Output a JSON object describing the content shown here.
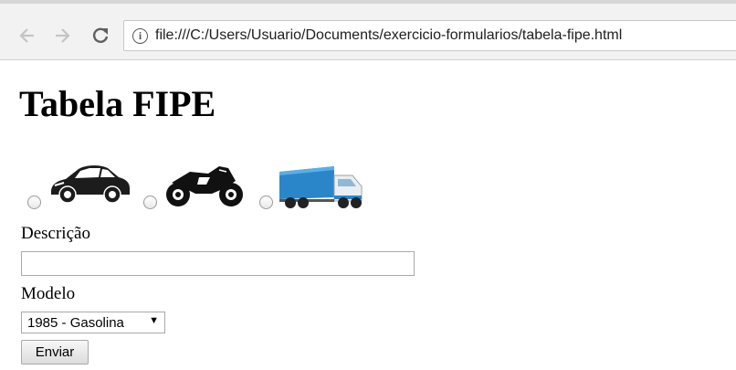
{
  "browser": {
    "url": "file:///C:/Users/Usuario/Documents/exercicio-formularios/tabela-fipe.html",
    "icons": {
      "back": "arrow-left-icon",
      "forward": "arrow-right-icon",
      "reload": "reload-icon",
      "info": "info-icon"
    },
    "info_glyph": "i"
  },
  "page": {
    "title": "Tabela FIPE",
    "vehicle_types": [
      {
        "icon": "car-icon",
        "selected": false
      },
      {
        "icon": "motorcycle-icon",
        "selected": false
      },
      {
        "icon": "truck-icon",
        "selected": false
      }
    ],
    "form": {
      "descricao_label": "Descrição",
      "descricao_value": "",
      "modelo_label": "Modelo",
      "modelo_selected": "1985 - Gasolina",
      "submit_label": "Enviar"
    }
  }
}
